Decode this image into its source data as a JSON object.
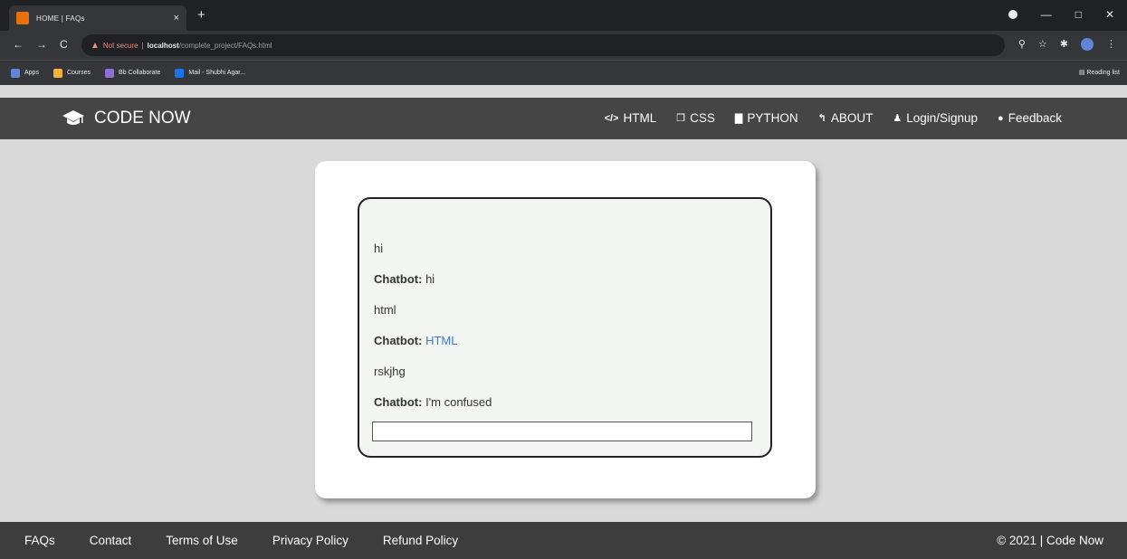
{
  "browser": {
    "tab_title": "HOME | FAQs",
    "tab_close": "×",
    "new_tab": "+",
    "url": {
      "warning": "Not secure",
      "separator": "|",
      "host": "localhost",
      "path": "/complete_project/FAQs.html"
    },
    "bookmarks": [
      {
        "label": "Apps",
        "color": "#5f86d8"
      },
      {
        "label": "Courses",
        "color": "#f6b13b"
      },
      {
        "label": "Bb Collaborate",
        "color": "#8e6fd8"
      },
      {
        "label": "Mail - Shubhi Agar...",
        "color": "#1a73e8"
      }
    ],
    "reading_list": "Reading list"
  },
  "header": {
    "brand": "CODE NOW",
    "nav": [
      {
        "icon": "</>",
        "label": "HTML"
      },
      {
        "icon": "❒",
        "label": "CSS"
      },
      {
        "icon": "▇",
        "label": "PYTHON"
      },
      {
        "icon": "↰",
        "label": "ABOUT"
      },
      {
        "icon": "♟",
        "label": "Login/Signup"
      },
      {
        "icon": "●",
        "label": "Feedback"
      }
    ]
  },
  "chat": {
    "bot_label": "Chatbot:",
    "messages": [
      {
        "user": "hi",
        "bot": "hi"
      },
      {
        "user": "html",
        "bot": "HTML"
      },
      {
        "user": "rskjhg",
        "bot": "I'm confused"
      }
    ],
    "input_value": ""
  },
  "footer": {
    "links": [
      "FAQs",
      "Contact",
      "Terms of Use",
      "Privacy Policy",
      "Refund Policy"
    ],
    "copyright": "© 2021 | Code Now"
  }
}
